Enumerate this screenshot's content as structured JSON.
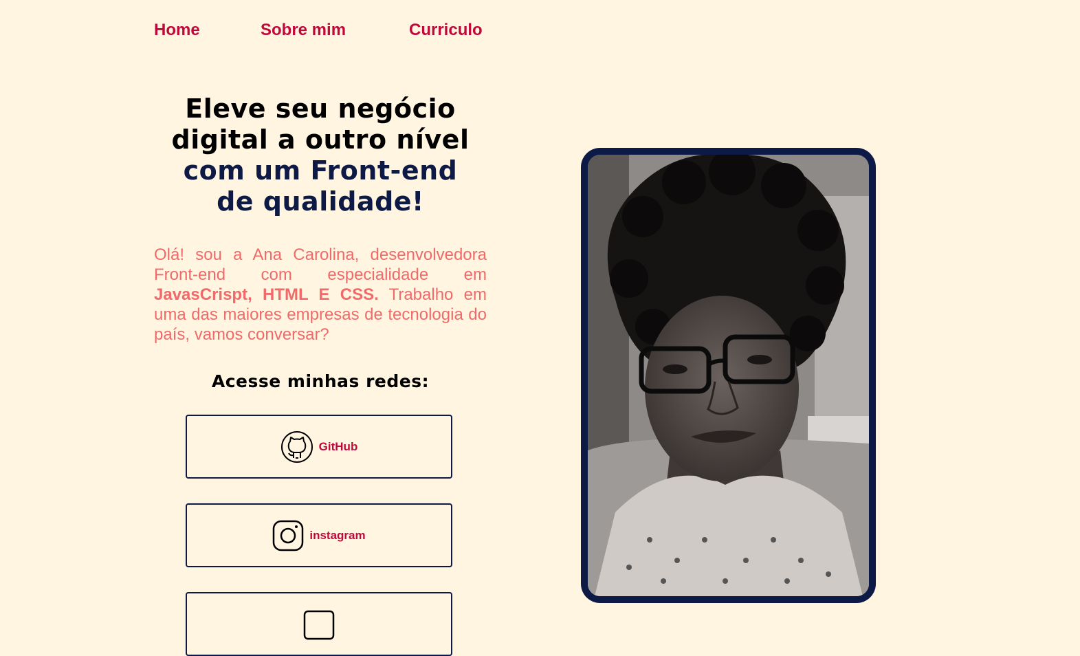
{
  "nav": {
    "home": "Home",
    "about": "Sobre mim",
    "resume": "Curriculo"
  },
  "hero": {
    "line1": "Eleve seu negócio",
    "line2": "digital a outro nível",
    "line3": "com um Front-end",
    "line4": "de qualidade!"
  },
  "intro": {
    "part1": "Olá! sou a Ana Carolina, desenvolvedora Front-end com especialidade em ",
    "highlight": "JavasCrispt, HTML E CSS.",
    "part2": " Trabalho em uma das maiores empresas de tecnologia do país, vamos conversar?"
  },
  "social": {
    "title": "Acesse minhas redes:",
    "github_label": "GitHub",
    "instagram_label": "instagram"
  },
  "colors": {
    "background": "#fff5e1",
    "accent": "#c0093b",
    "navy": "#0d1a45",
    "intro_text": "#f06a6a"
  },
  "icons": {
    "github": "github-icon",
    "instagram": "instagram-icon",
    "third": "linkedin-icon"
  }
}
